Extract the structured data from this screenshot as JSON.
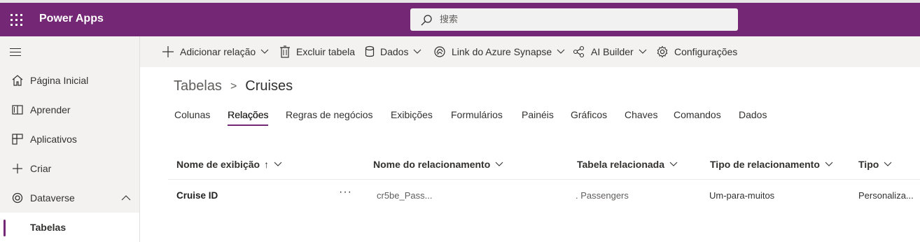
{
  "header": {
    "app_title": "Power Apps",
    "search_placeholder": "搜索",
    "brand_color": "#742774"
  },
  "nav": {
    "items": [
      {
        "label": "Página Inicial",
        "icon": "home-icon"
      },
      {
        "label": "Aprender",
        "icon": "book-icon"
      },
      {
        "label": "Aplicativos",
        "icon": "apps-icon"
      },
      {
        "label": "Criar",
        "icon": "plus-icon"
      },
      {
        "label": "Dataverse",
        "icon": "dataverse-icon",
        "expanded": true
      },
      {
        "label": "Tabelas",
        "selected": true
      }
    ]
  },
  "commands": [
    {
      "label": "Adicionar relação",
      "icon": "plus-icon",
      "dropdown": true
    },
    {
      "label": "Excluir tabela",
      "icon": "trash-icon",
      "dropdown": false
    },
    {
      "label": "Dados",
      "icon": "database-icon",
      "dropdown": true
    },
    {
      "label": "Link do Azure Synapse",
      "icon": "synapse-icon",
      "dropdown": true
    },
    {
      "label": "AI Builder",
      "icon": "ai-builder-icon",
      "dropdown": true
    },
    {
      "label": "Configurações",
      "icon": "gear-icon",
      "dropdown": false
    }
  ],
  "breadcrumb": {
    "parent": "Tabelas",
    "separator": ">",
    "current": "Cruises"
  },
  "tabs": [
    {
      "label": "Colunas"
    },
    {
      "label": "Relações",
      "active": true
    },
    {
      "label": "Regras de negócios"
    },
    {
      "label": "Exibições"
    },
    {
      "label": "Formulários"
    },
    {
      "label": "Painéis"
    },
    {
      "label": "Gráficos"
    },
    {
      "label": "Chaves"
    },
    {
      "label": "Comandos"
    },
    {
      "label": "Dados"
    }
  ],
  "table": {
    "columns": [
      {
        "label": "Nome de exibição",
        "sort": "↑"
      },
      {
        "label": "Nome do relacionamento"
      },
      {
        "label": "Tabela relacionada"
      },
      {
        "label": "Tipo de relacionamento"
      },
      {
        "label": "Tipo"
      }
    ],
    "rows": [
      {
        "display_name": "Cruise ID",
        "more": "···",
        "relationship_name": "cr5be_Pass...",
        "related_table": ". Passengers",
        "relationship_type": "Um-para-muitos",
        "type": "Personaliza..."
      }
    ]
  }
}
